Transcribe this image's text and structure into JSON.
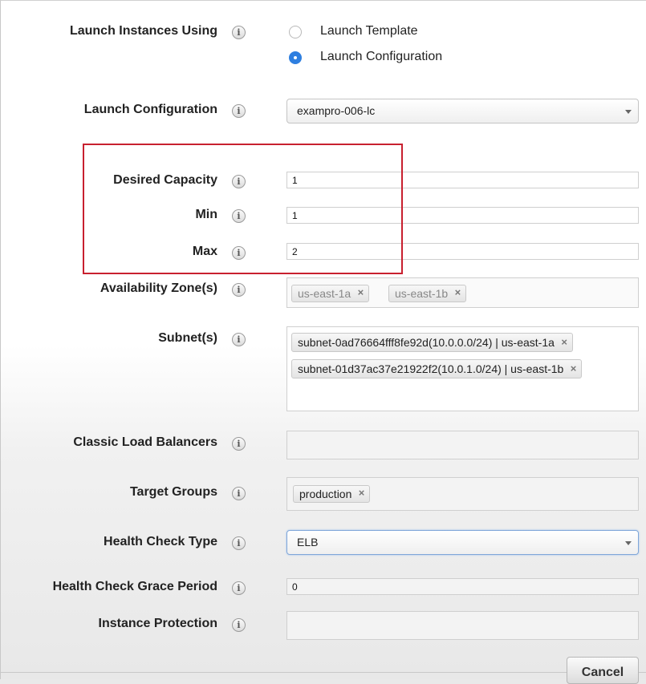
{
  "launch_instances": {
    "label": "Launch Instances Using",
    "options": [
      {
        "label": "Launch Template",
        "selected": false
      },
      {
        "label": "Launch Configuration",
        "selected": true
      }
    ]
  },
  "launch_configuration": {
    "label": "Launch Configuration",
    "value": "exampro-006-lc"
  },
  "desired_capacity": {
    "label": "Desired Capacity",
    "value": "1"
  },
  "min": {
    "label": "Min",
    "value": "1"
  },
  "max": {
    "label": "Max",
    "value": "2"
  },
  "availability_zones": {
    "label": "Availability Zone(s)",
    "tags": [
      "us-east-1a",
      "us-east-1b"
    ]
  },
  "subnets": {
    "label": "Subnet(s)",
    "tags": [
      "subnet-0ad76664fff8fe92d(10.0.0.0/24) | us-east-1a",
      "subnet-01d37ac37e21922f2(10.0.1.0/24) | us-east-1b"
    ]
  },
  "classic_load_balancers": {
    "label": "Classic Load Balancers"
  },
  "target_groups": {
    "label": "Target Groups",
    "tags": [
      "production"
    ]
  },
  "health_check_type": {
    "label": "Health Check Type",
    "value": "ELB"
  },
  "health_check_grace_period": {
    "label": "Health Check Grace Period",
    "value": "0"
  },
  "instance_protection": {
    "label": "Instance Protection"
  },
  "cancel_label": "Cancel",
  "info_glyph": "i",
  "remove_glyph": "×",
  "colors": {
    "highlight_border": "#c8202f",
    "radio_selected": "#2e7fe0"
  }
}
